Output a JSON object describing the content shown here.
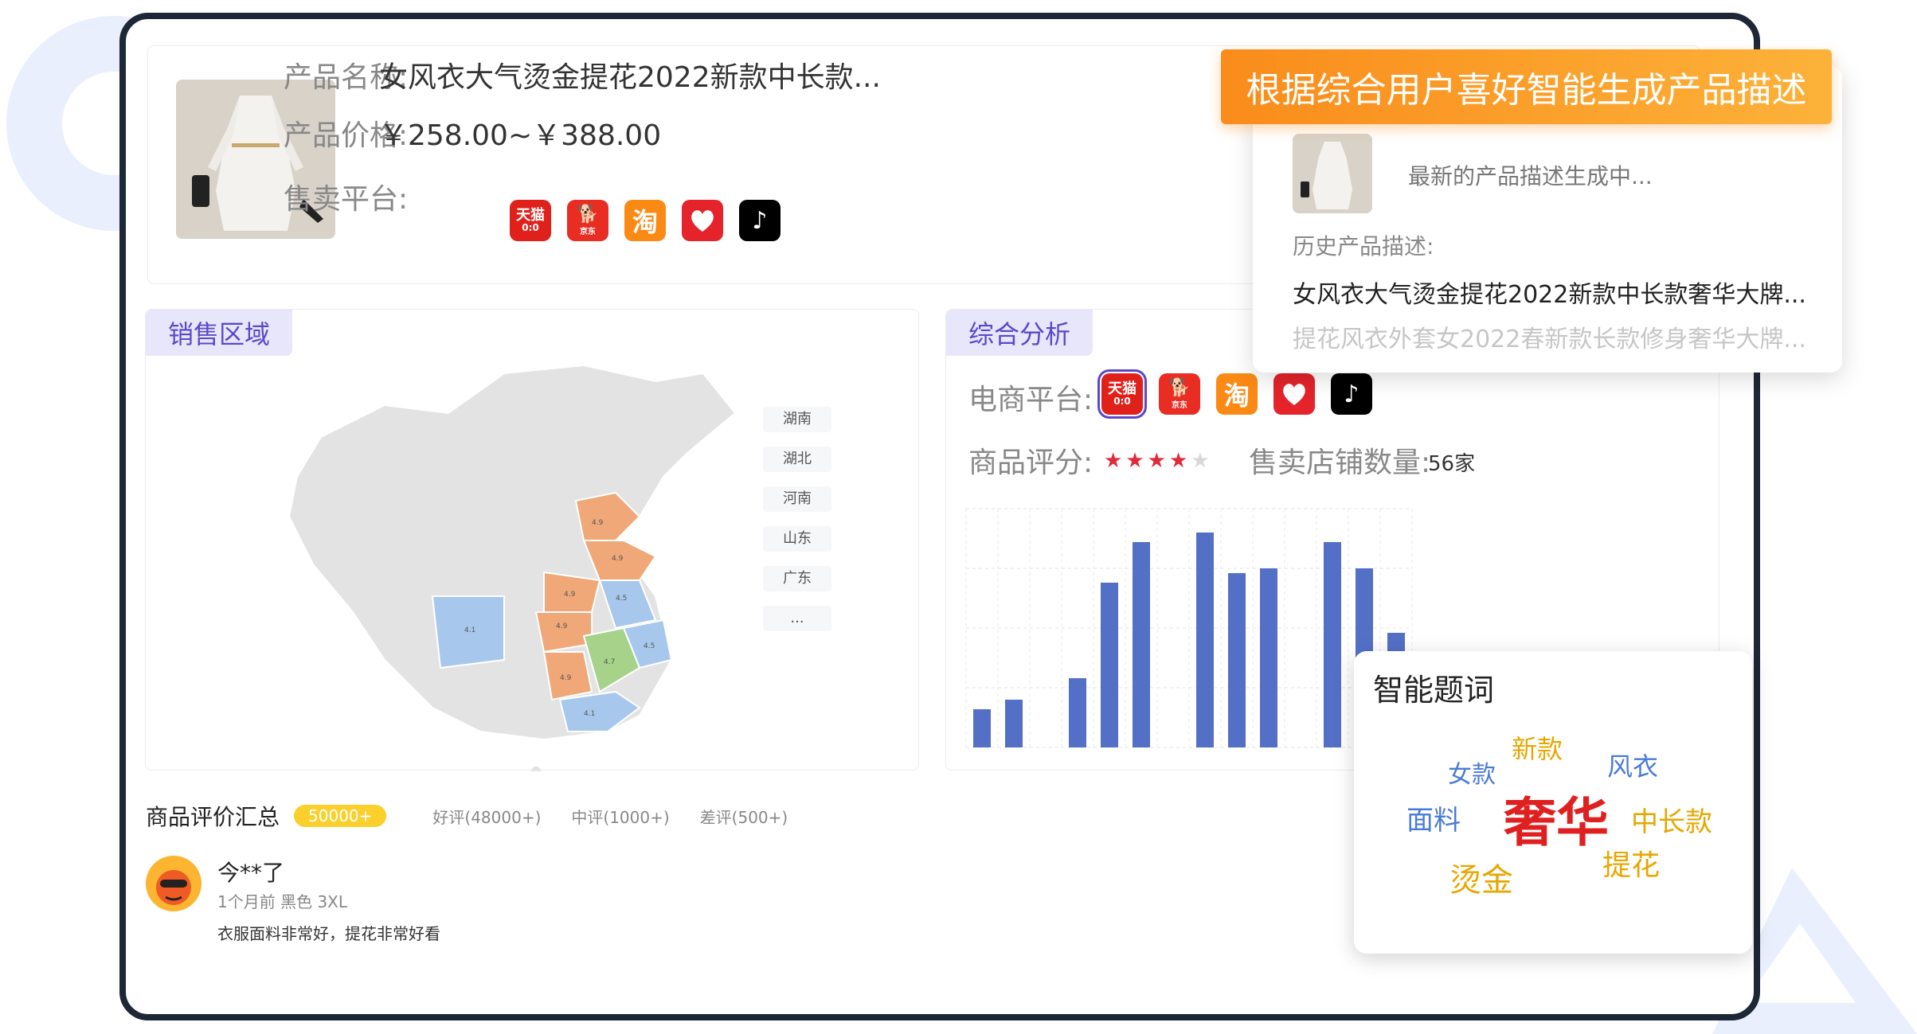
{
  "product": {
    "name_label": "产品名称:",
    "name_value": "女风衣大气烫金提花2022新款中长款...",
    "price_label": "产品价格:",
    "price_value": "￥258.00~￥388.00",
    "platform_label": "售卖平台:",
    "platforms": [
      {
        "icon": "tmall-icon",
        "text": "天猫",
        "sub": "0:0"
      },
      {
        "icon": "jd-icon",
        "text": "京东"
      },
      {
        "icon": "taobao-icon",
        "text": "淘"
      },
      {
        "icon": "pinduoduo-icon"
      },
      {
        "icon": "tiktok-icon",
        "text": "♪"
      }
    ]
  },
  "popup": {
    "banner": "根据综合用户喜好智能生成产品描述",
    "generating": "最新的产品描述生成中...",
    "history_label": "历史产品描述:",
    "history": [
      "女风衣大气烫金提花2022新款中长款奢华大牌...",
      "提花风衣外套女2022春新款长款修身奢华大牌..."
    ]
  },
  "region": {
    "tab": "销售区域",
    "legend": [
      "湖南",
      "湖北",
      "河南",
      "山东",
      "广东",
      "..."
    ],
    "map_labels": [
      "4.9",
      "4.9",
      "4.9",
      "4.5",
      "4.1",
      "4.9",
      "4.9",
      "4.7",
      "4.5",
      "4.1"
    ]
  },
  "analysis": {
    "tab": "综合分析",
    "platform_label": "电商平台:",
    "rating_label": "商品评分:",
    "rating_stars": 4,
    "rating_max": 5,
    "store_label": "售卖店铺数量:",
    "store_value": "56家"
  },
  "chart_data": {
    "type": "bar",
    "values": [
      16,
      20,
      0,
      29,
      69,
      86,
      0,
      90,
      73,
      75,
      0,
      86,
      75,
      48
    ],
    "ylim": [
      0,
      100
    ],
    "grid": true,
    "color": "#5470c6"
  },
  "wordcloud": {
    "title": "智能题词",
    "words": [
      {
        "text": "新款",
        "color": "#e6a700"
      },
      {
        "text": "女款",
        "color": "#4a7bd6"
      },
      {
        "text": "风衣",
        "color": "#4a7bd6"
      },
      {
        "text": "面料",
        "color": "#4a7bd6"
      },
      {
        "text": "奢华",
        "color": "#e02020"
      },
      {
        "text": "中长款",
        "color": "#e6a700"
      },
      {
        "text": "提花",
        "color": "#e6a700"
      },
      {
        "text": "烫金",
        "color": "#e6a700"
      }
    ]
  },
  "reviews": {
    "title": "商品评价汇总",
    "total_badge": "50000+",
    "filters": [
      "好评(48000+)",
      "中评(1000+)",
      "差评(500+)"
    ],
    "items": [
      {
        "user": "今**了",
        "meta": "1个月前 黑色 3XL",
        "text": "衣服面料非常好，提花非常好看"
      }
    ]
  }
}
